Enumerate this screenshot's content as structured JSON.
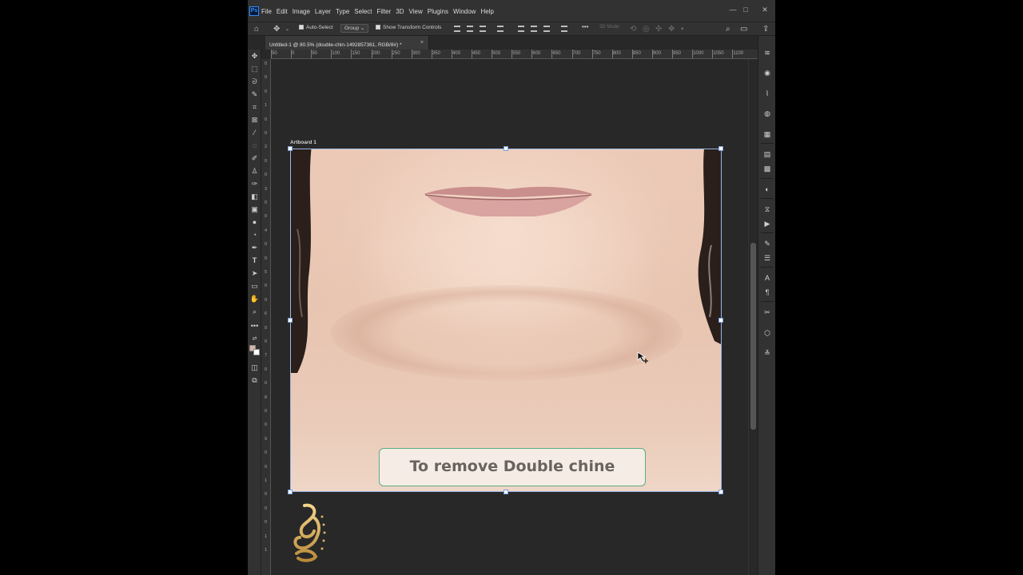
{
  "app": {
    "logo_text": "Ps"
  },
  "menu": [
    "File",
    "Edit",
    "Image",
    "Layer",
    "Type",
    "Select",
    "Filter",
    "3D",
    "View",
    "Plugins",
    "Window",
    "Help"
  ],
  "window_controls": {
    "minimize": "—",
    "maximize": "□",
    "close": "✕"
  },
  "options_bar": {
    "auto_select_label": "Auto-Select",
    "auto_select_checked": true,
    "group_select_value": "Group",
    "show_transform_label": "Show Transform Controls",
    "show_transform_checked": true,
    "more_label": "•••",
    "mode_3d_label": "3D Mode:"
  },
  "document_tab": {
    "title": "Untitled-1 @ 80.5% (double-chin-1492857361, RGB/8#) *",
    "close_label": "×"
  },
  "ruler_top_labels": [
    "50",
    "0",
    "50",
    "100",
    "150",
    "200",
    "250",
    "300",
    "350",
    "400",
    "450",
    "500",
    "550",
    "600",
    "650",
    "700",
    "750",
    "800",
    "850",
    "900",
    "950",
    "1000",
    "1050",
    "1100"
  ],
  "ruler_left_labels": [
    "0",
    "0",
    "0",
    "1",
    "0",
    "0",
    "2",
    "0",
    "0",
    "3",
    "0",
    "0",
    "4",
    "0",
    "0",
    "5",
    "0",
    "0",
    "6",
    "0",
    "0",
    "7",
    "0",
    "0",
    "8",
    "0",
    "0",
    "9",
    "0",
    "0",
    "1",
    "0",
    "0",
    "0",
    "1",
    "1"
  ],
  "artboard": {
    "label": "Artboard 1",
    "caption": "To remove Double chine"
  },
  "tools": [
    "move-icon",
    "marquee-icon",
    "lasso-icon",
    "quick-select-icon",
    "crop-icon",
    "frame-icon",
    "eyedropper-icon",
    "healing-icon",
    "brush-icon",
    "stamp-icon",
    "history-brush-icon",
    "eraser-icon",
    "gradient-icon",
    "blur-icon",
    "dodge-icon",
    "pen-icon",
    "type-icon",
    "path-select-icon",
    "rectangle-icon",
    "hand-icon",
    "zoom-icon",
    "more-tools-icon"
  ],
  "colors": {
    "foreground": "#d4b8a4",
    "background": "#ffffff",
    "caption_border": "#5cad7f",
    "caption_text": "#6a625e",
    "selection_handles": "#7aa0e0"
  }
}
